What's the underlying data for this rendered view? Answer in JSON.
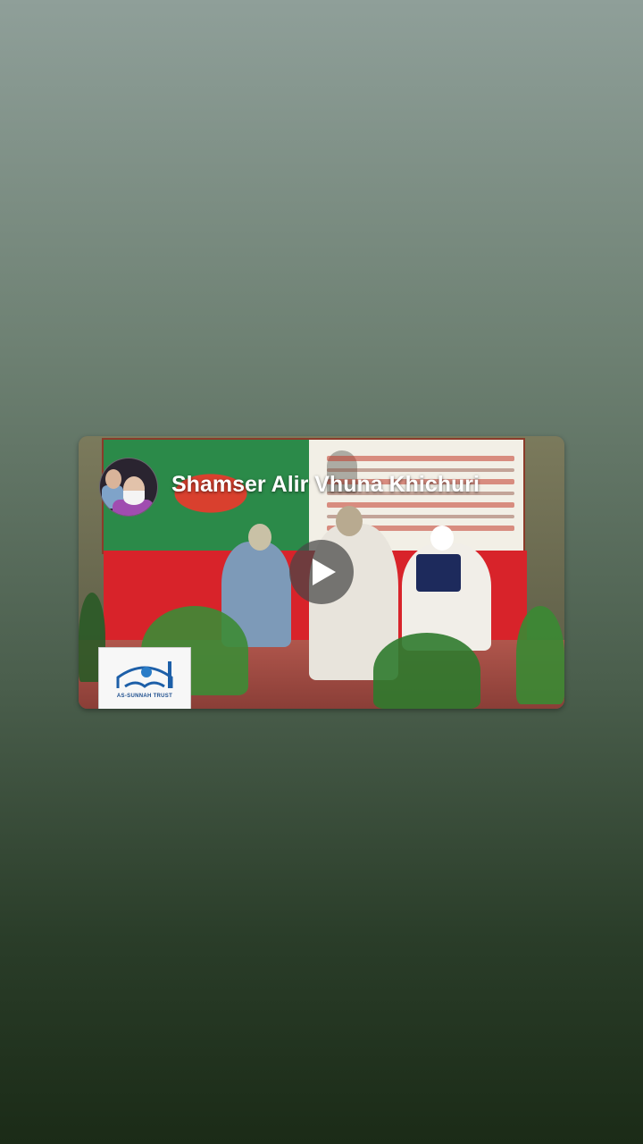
{
  "video": {
    "title": "Shamser Alir Vhuna Khichuri",
    "play_icon": "play-icon",
    "channel_avatar": "channel-avatar",
    "watermark_logo": "as-sunnah-trust-logo",
    "watermark_caption": "AS-SUNNAH TRUST"
  },
  "colors": {
    "bg_top": "#8f9f99",
    "bg_bottom": "#1b2b17",
    "title_text": "#ffffff",
    "play_button_bg": "#464646"
  }
}
